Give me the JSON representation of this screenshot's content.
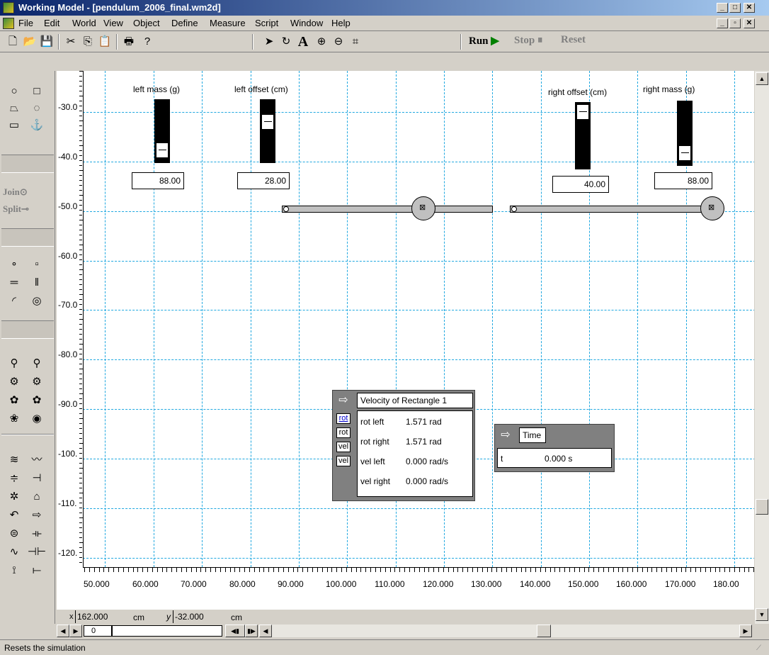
{
  "window": {
    "title": "Working Model - [pendulum_2006_final.wm2d]"
  },
  "menu": [
    "File",
    "Edit",
    "World",
    "View",
    "Object",
    "Define",
    "Measure",
    "Script",
    "Window",
    "Help"
  ],
  "toolbar": {
    "run": "Run",
    "stop": "Stop",
    "reset": "Reset"
  },
  "sidepanel": {
    "join": "Join",
    "split": "Split"
  },
  "canvas": {
    "y_ticks": [
      "-30.0",
      "-40.0",
      "-50.0",
      "-60.0",
      "-70.0",
      "-80.0",
      "-90.0",
      "-100.",
      "-110.",
      "-120."
    ],
    "x_ticks": [
      "50.000",
      "60.000",
      "70.000",
      "80.000",
      "90.000",
      "100.000",
      "110.000",
      "120.000",
      "130.000",
      "140.000",
      "150.000",
      "160.000",
      "170.000",
      "180.00"
    ],
    "controls": {
      "left_mass": {
        "label": "left mass (g)",
        "value": "88.00"
      },
      "left_offset": {
        "label": "left offset (cm)",
        "value": "28.00"
      },
      "right_offset": {
        "label": "right offset (cm)",
        "value": "40.00"
      },
      "right_mass": {
        "label": "right mass (g)",
        "value": "88.00"
      }
    },
    "velocity_meter": {
      "title": "Velocity of Rectangle 1",
      "tags": [
        "rot",
        "rot",
        "vel",
        "vel"
      ],
      "rows": [
        {
          "label": "rot left",
          "value": "1.571 rad"
        },
        {
          "label": "rot right",
          "value": "1.571 rad"
        },
        {
          "label": "vel left",
          "value": "0.000 rad/s"
        },
        {
          "label": "vel right",
          "value": "0.000 rad/s"
        }
      ]
    },
    "time_meter": {
      "title": "Time",
      "label": "t",
      "value": "0.000 s"
    }
  },
  "coords": {
    "x_label": "x",
    "x_value": "162.000",
    "x_unit": "cm",
    "y_label": "y",
    "y_value": "-32.000",
    "y_unit": "cm"
  },
  "frame": {
    "value": "0"
  },
  "status": {
    "text": "Resets the simulation"
  }
}
